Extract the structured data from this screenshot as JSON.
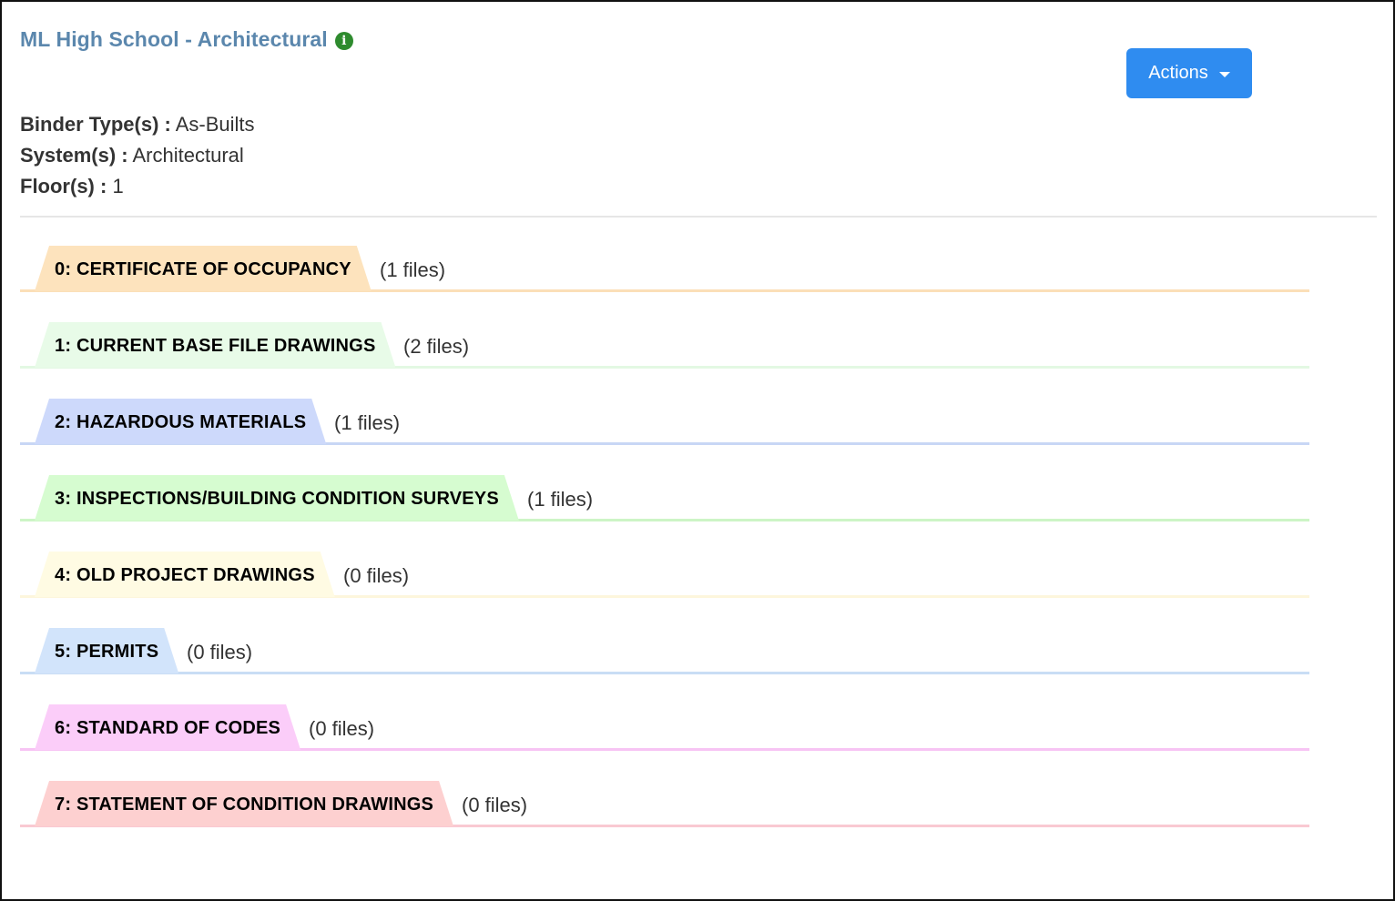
{
  "header": {
    "title": "ML High School - Architectural",
    "info_icon": "info-circle-icon",
    "info_glyph": "i",
    "actions_label": "Actions",
    "actions_color": "#2f8cf0"
  },
  "meta": {
    "binder_type_label": "Binder Type(s) :",
    "binder_type_value": "As-Builts",
    "system_label": "System(s) :",
    "system_value": "Architectural",
    "floor_label": "Floor(s) :",
    "floor_value": "1"
  },
  "sections": [
    {
      "label": "0: CERTIFICATE OF OCCUPANCY",
      "count": "(1 files)",
      "tab_color": "#fde3bd",
      "line_color": "#fbdfb8"
    },
    {
      "label": "1: CURRENT BASE FILE DRAWINGS",
      "count": "(2 files)",
      "tab_color": "#e8fbe8",
      "line_color": "#e3f8e3"
    },
    {
      "label": "2: HAZARDOUS MATERIALS",
      "count": "(1 files)",
      "tab_color": "#cdd9fb",
      "line_color": "#c8d7f5"
    },
    {
      "label": "3: INSPECTIONS/BUILDING CONDITION SURVEYS",
      "count": "(1 files)",
      "tab_color": "#d6fcd0",
      "line_color": "#cdf5c6"
    },
    {
      "label": "4: OLD PROJECT DRAWINGS",
      "count": "(0 files)",
      "tab_color": "#fffbe3",
      "line_color": "#fdf6dc"
    },
    {
      "label": "5: PERMITS",
      "count": "(0 files)",
      "tab_color": "#d2e4fb",
      "line_color": "#c9ddf5"
    },
    {
      "label": "6: STANDARD OF CODES",
      "count": "(0 files)",
      "tab_color": "#fbcdf9",
      "line_color": "#f7c4f4"
    },
    {
      "label": "7: STATEMENT OF CONDITION DRAWINGS",
      "count": "(0 files)",
      "tab_color": "#fdd0d0",
      "line_color": "#f9c9d2"
    }
  ]
}
